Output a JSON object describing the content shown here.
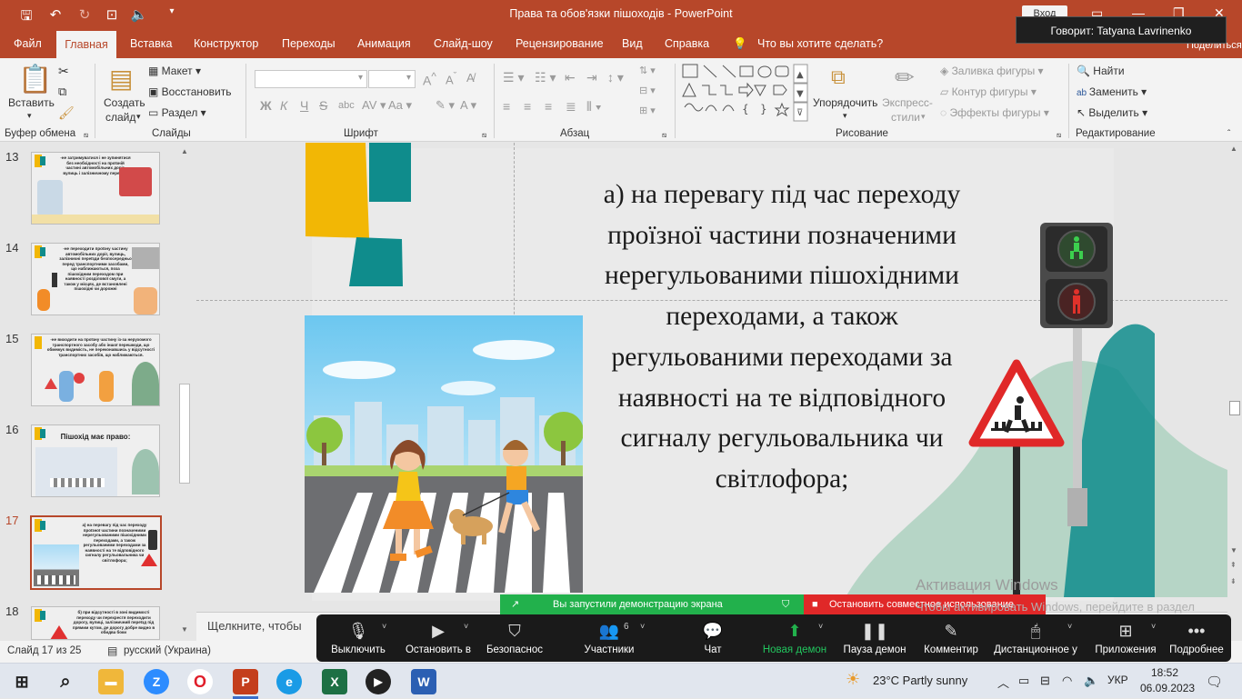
{
  "titlebar": {
    "title": "Права та обов'язки пішоходів  -  PowerPoint",
    "signin": "Вход",
    "speaking": "Говорит: Tatyana Lavrinenko",
    "share_label": "Поделиться"
  },
  "tabs": [
    "Файл",
    "Главная",
    "Вставка",
    "Конструктор",
    "Переходы",
    "Анимация",
    "Слайд-шоу",
    "Рецензирование",
    "Вид",
    "Справка"
  ],
  "tell_me": "Что вы хотите сделать?",
  "ribbon": {
    "clipboard": {
      "paste": "Вставить",
      "label": "Буфер обмена"
    },
    "slides": {
      "create": "Создать",
      "create2": "слайд",
      "layout": "Макет",
      "reset": "Восстановить",
      "section": "Раздел",
      "label": "Слайды"
    },
    "font": {
      "label": "Шрифт",
      "bold": "Ж",
      "italic": "К",
      "underline": "Ч",
      "strike": "S",
      "aa": "Aa",
      "color": "A"
    },
    "paragraph": {
      "label": "Абзац"
    },
    "drawing": {
      "arrange": "Упорядочить",
      "quick1": "Экспресс-",
      "quick2": "стили",
      "fill": "Заливка фигуры",
      "outline": "Контур фигуры",
      "effects": "Эффекты фигуры",
      "label": "Рисование"
    },
    "editing": {
      "find": "Найти",
      "replace": "Заменить",
      "select": "Выделить",
      "label": "Редактирование"
    }
  },
  "thumbnails": [
    {
      "num": "13",
      "text": "-не затримуватися і не зупинятися без необхідності на проїзній частині автомобільних доріг, вулиць і залізничному переїзді;"
    },
    {
      "num": "14",
      "text": "-не переходити проїзну частину автомобільних доріг, вулиць, залізничні переїзди безпосередньо перед транспортними засобами, що наближаються, поза пішохідним переходом при наявності розділової смуги, а також у місцях, де встановлені пішохідні чи дорожні"
    },
    {
      "num": "15",
      "text": "-не виходити на проїзну частину із-за нерухомого транспортного засобу або іншої перешкоди, що обмежує видимість, не переконавшись у відсутності транспортних засобів, що наближаються."
    },
    {
      "num": "16",
      "text": "Пішохід має право:"
    },
    {
      "num": "17",
      "text": "а) на перевагу під час переходу проїзної частини позначеними нерегульованими пішохідними переходами, а також регульованими переходами за наявності на те відповідного сигналу регульовальника чи світлофора;"
    },
    {
      "num": "18",
      "text": "б) при відсутності в зоні видимості переходу чи перехрестя переходити дорогу, вулиці, залізничний переїзд під прямим кутом, де дорогу добре видно в обидва боки"
    }
  ],
  "slide": {
    "text": "а) на перевагу під час переходу проїзної частини позначеними нерегульованими пішохідними переходами, а також регульованими переходами за наявності на те відповідного сигналу регульовальника чи світлофора;"
  },
  "notes_placeholder": "Щелкните, чтобы",
  "statusbar": {
    "slide": "Слайд 17 из 25",
    "language": "русский (Украина)"
  },
  "share_banner": {
    "green": "Вы запустили демонстрацию экрана",
    "red": "Остановить совместное использование"
  },
  "zoom": {
    "participants_count": "6",
    "items": [
      "Выключить",
      "Остановить в",
      "Безопаснос",
      "Участники",
      "Чат",
      "Новая демон",
      "Пауза демон",
      "Комментир",
      "Дистанционное у",
      "Приложения",
      "Подробнее"
    ]
  },
  "activation": {
    "title": "Активация Windows",
    "body": "Чтобы активировать Windows, перейдите в раздел \"Параметры\"."
  },
  "taskbar": {
    "weather": "23°C  Partly sunny",
    "lang": "УКР",
    "time": "18:52",
    "date": "06.09.2023"
  },
  "colors": {
    "accent": "#b7472a",
    "zoom_green": "#22b14c",
    "zoom_red": "#e02828",
    "teal": "#0f8c8c",
    "yellow": "#f2b705"
  }
}
